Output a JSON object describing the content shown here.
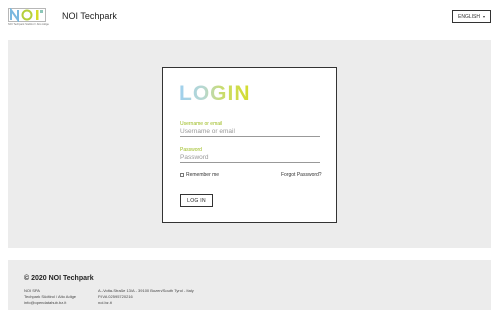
{
  "header": {
    "logo_caption": "NOI Techpark Südtirol / Alto Adige",
    "site_title": "NOI Techpark",
    "language_label": "ENGLISH",
    "language_caret": "▾"
  },
  "login": {
    "title": "LOGIN",
    "username_label": "Username or email",
    "username_placeholder": "Username or email",
    "username_value": "",
    "password_label": "Password",
    "password_placeholder": "Password",
    "password_value": "",
    "remember_label": "Remember me",
    "remember_checked": false,
    "forgot_label": "Forgot Password?",
    "submit_label": "LOG IN"
  },
  "footer": {
    "copyright": "© 2020 NOI Techpark",
    "col1": [
      "NOI SPA",
      "Techpark Südtirol / Alto Adige",
      "info@opendatahub.bz.it"
    ],
    "col2": [
      "A.-Volta-Straße 13/A - 39100 Bozen/South Tyrol - Italy",
      "P.IVA 02595720216",
      "noi.bz.it"
    ]
  },
  "colors": {
    "accent_green": "#9bbb1e",
    "logo_blue": "#9fd0ee",
    "logo_yellow": "#d5dc2a"
  }
}
